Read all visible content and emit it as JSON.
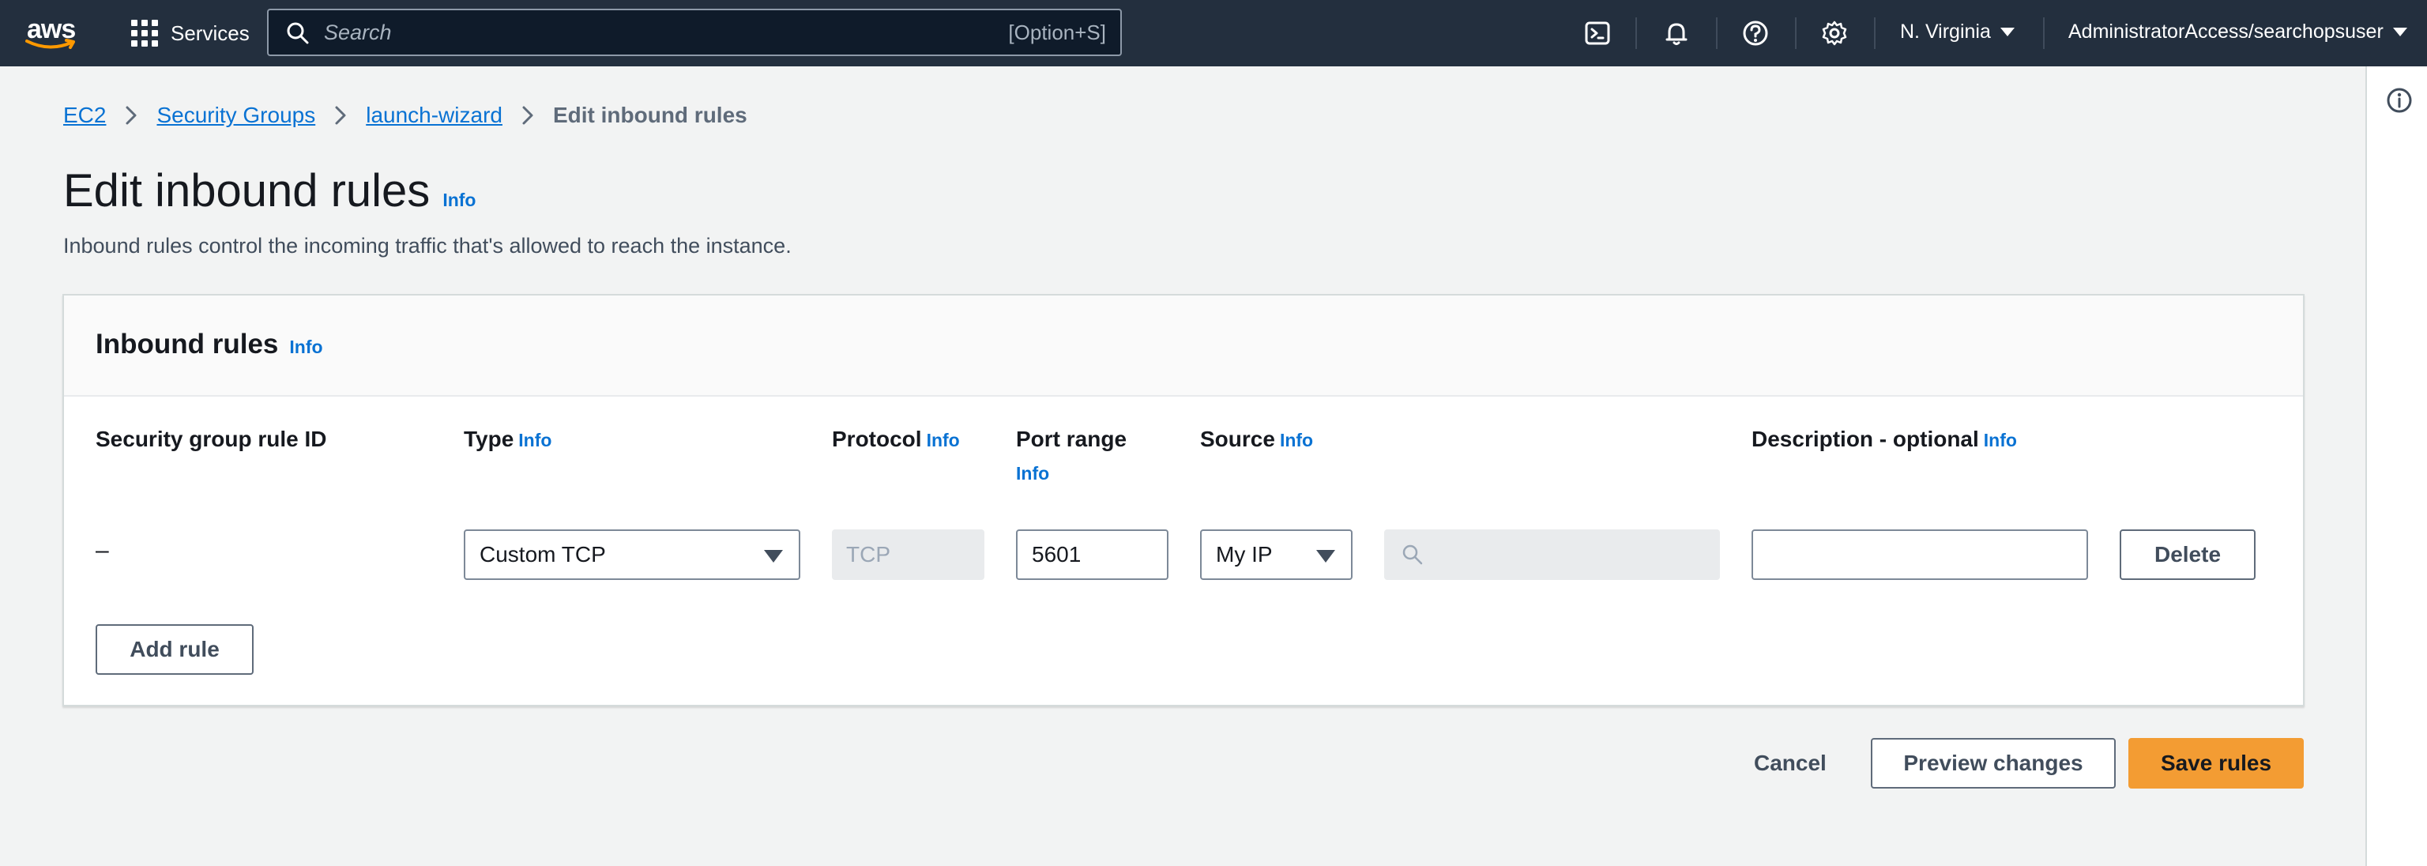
{
  "nav": {
    "logo_text": "aws",
    "services_label": "Services",
    "search_placeholder": "Search",
    "search_shortcut": "[Option+S]",
    "region": "N. Virginia",
    "account": "AdministratorAccess/searchopsuser",
    "icons": [
      "cloudshell-icon",
      "bell-icon",
      "help-icon",
      "gear-icon"
    ]
  },
  "breadcrumb": {
    "items": [
      "EC2",
      "Security Groups",
      "launch-wizard"
    ],
    "current": "Edit inbound rules"
  },
  "page": {
    "title": "Edit inbound rules",
    "title_info": "Info",
    "description": "Inbound rules control the incoming traffic that's allowed to reach the instance."
  },
  "container": {
    "title": "Inbound rules",
    "title_info": "Info",
    "columns": {
      "rule_id": "Security group rule ID",
      "type": "Type",
      "protocol": "Protocol",
      "port_range": "Port range",
      "source": "Source",
      "description": "Description - optional",
      "info": "Info"
    },
    "row": {
      "rule_id": "–",
      "type": "Custom TCP",
      "protocol": "TCP",
      "port_range": "5601",
      "source": "My IP",
      "source_search": "",
      "description": "",
      "delete_label": "Delete"
    },
    "add_rule_label": "Add rule"
  },
  "actions": {
    "cancel": "Cancel",
    "preview": "Preview changes",
    "save": "Save rules"
  },
  "colors": {
    "nav_bg": "#232f3e",
    "link": "#0972d3",
    "primary": "#f39c33"
  }
}
